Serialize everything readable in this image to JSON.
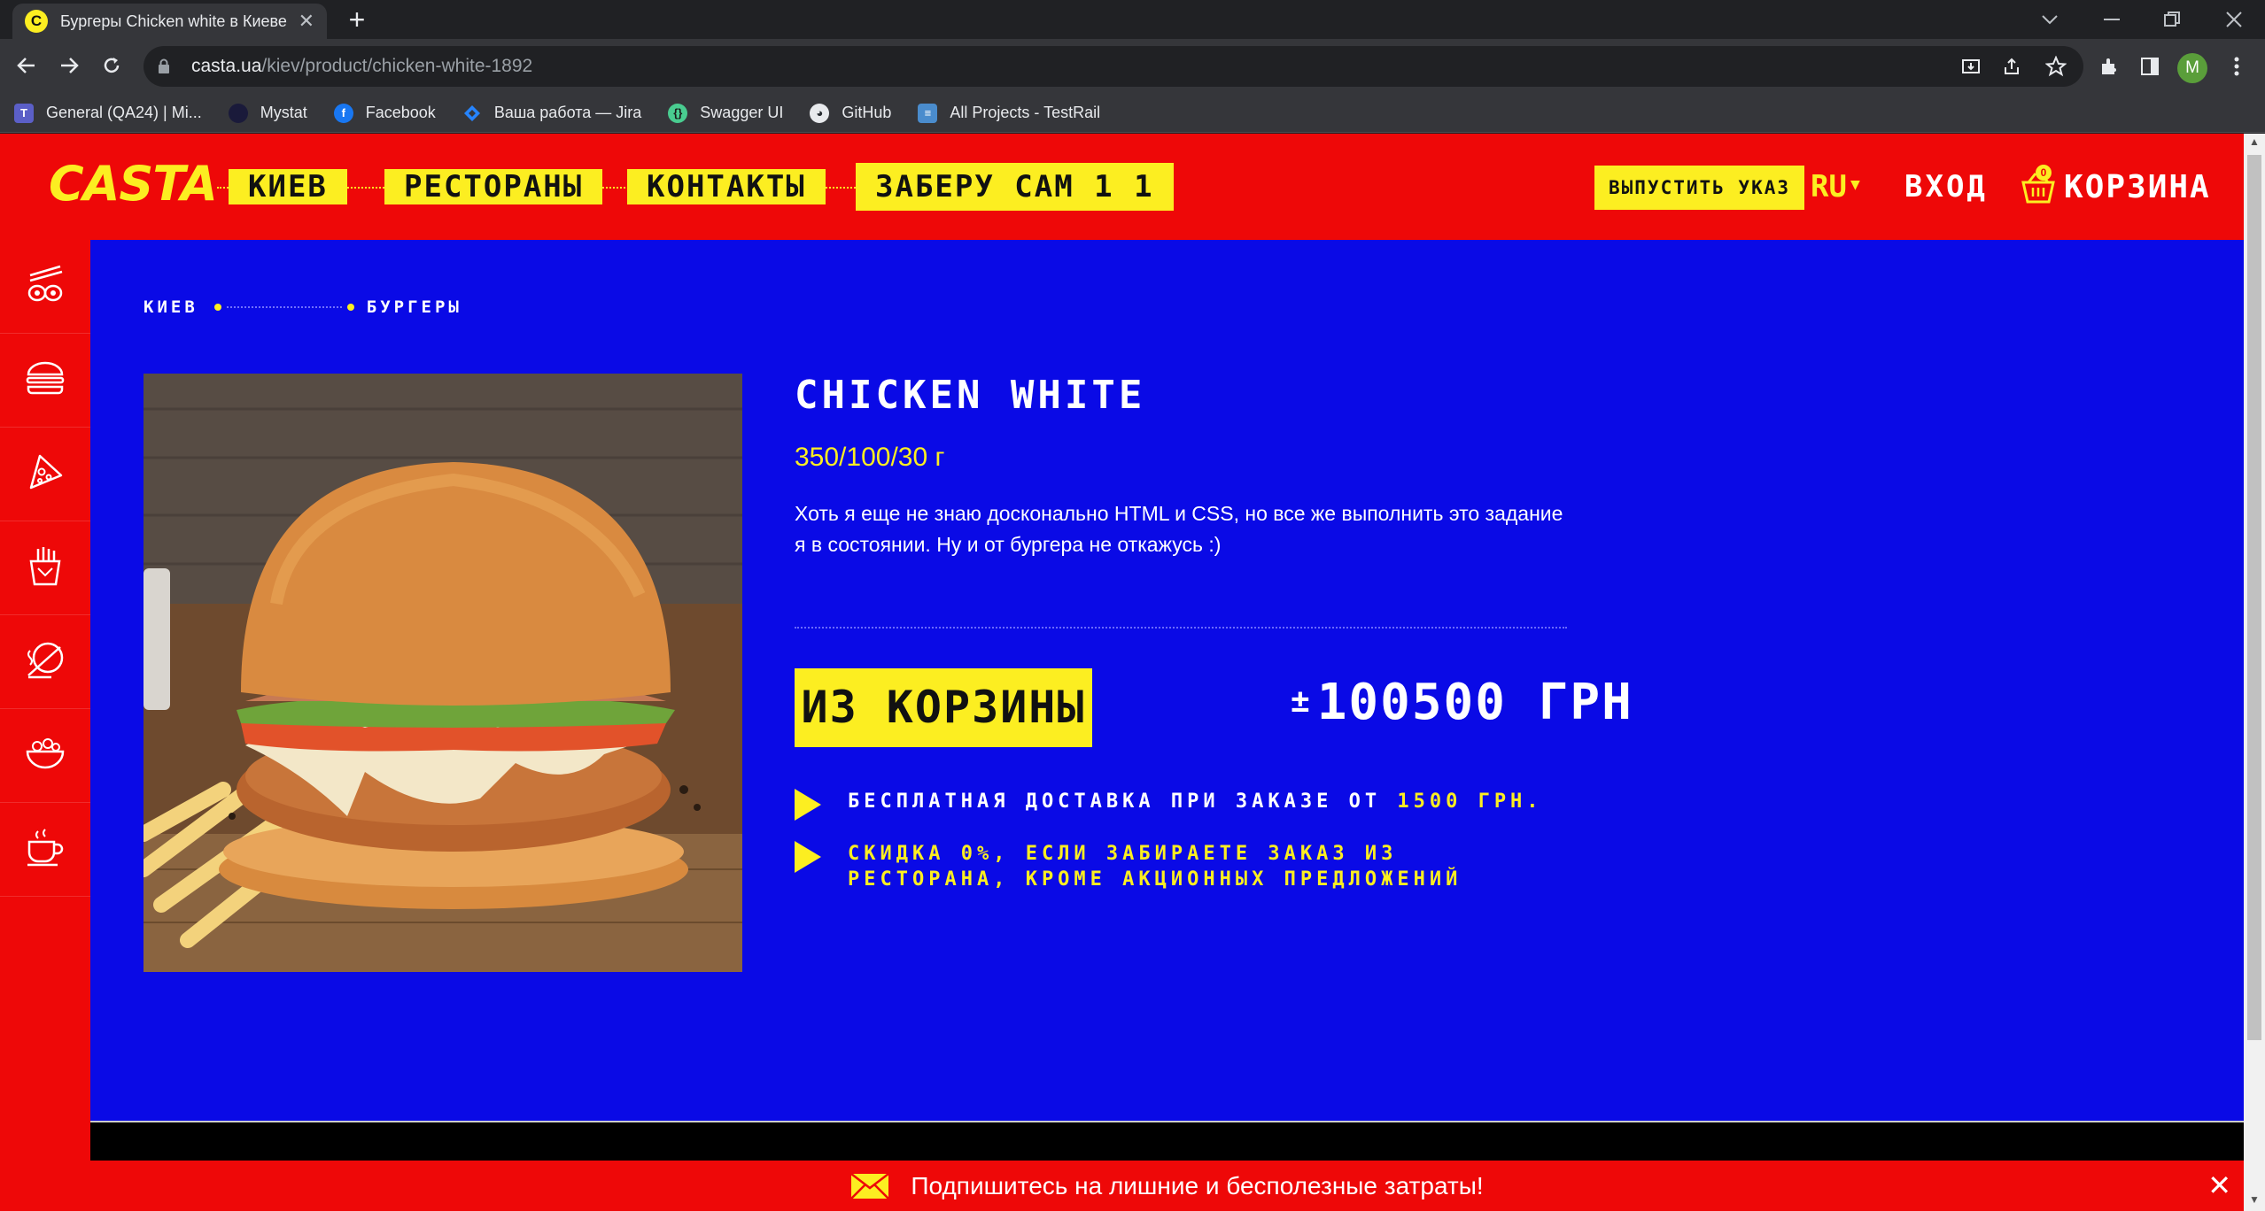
{
  "browser": {
    "tab_title": "Бургеры Chicken white в Киеве |",
    "tab_close": "✕",
    "new_tab": "+",
    "url_host": "casta.ua",
    "url_path": "/kiev/product/chicken-white-1892",
    "profile_initial": "M",
    "bookmarks": [
      {
        "label": "General (QA24) | Mi...",
        "icon": "teams-icon",
        "color": "#5b5fc7"
      },
      {
        "label": "Mystat",
        "icon": "mystat-icon",
        "color": "#1a1a3a"
      },
      {
        "label": "Facebook",
        "icon": "facebook-icon",
        "color": "#1877f2"
      },
      {
        "label": "Ваша работа — Jira",
        "icon": "jira-icon",
        "color": "#2684ff"
      },
      {
        "label": "Swagger UI",
        "icon": "swagger-icon",
        "color": "#49cc90"
      },
      {
        "label": "GitHub",
        "icon": "github-icon",
        "color": "#24292e"
      },
      {
        "label": "All Projects - TestRail",
        "icon": "testrail-icon",
        "color": "#4a8ccd"
      }
    ]
  },
  "header": {
    "logo": "CASTA",
    "nav": [
      "КИЕВ",
      "РЕСТОРАНЫ",
      "КОНТАКТЫ",
      "ЗАБЕРУ САМ 1 1"
    ],
    "ukaz_button": "ВЫПУСТИТЬ УКАЗ",
    "lang": "RU",
    "login": "ВХОД",
    "cart_label": "КОРЗИНА",
    "cart_count": "0"
  },
  "sidebar": {
    "items": [
      "sushi-icon",
      "burger-icon",
      "pizza-icon",
      "fries-icon",
      "hot-dish-icon",
      "salad-icon",
      "coffee-icon"
    ]
  },
  "breadcrumbs": [
    "КИЕВ",
    "БУРГЕРЫ"
  ],
  "product": {
    "title": "CHICKEN WHITE",
    "weight": "350/100/30 г",
    "description": "Хоть я еще не знаю досконально HTML и CSS, но все же выполнить это задание я в состоянии. Ну и от бургера не откажусь :)",
    "button": "ИЗ КОРЗИНЫ",
    "price_prefix": "±",
    "price": "100500 ГРН",
    "delivery_note": "БЕСПЛАТНАЯ ДОСТАВКА ПРИ ЗАКАЗЕ ОТ ",
    "delivery_amount": "1500 ГРН.",
    "discount_note": "СКИДКА 0%, ЕСЛИ ЗАБИРАЕТЕ ЗАКАЗ ИЗ РЕСТОРАНА, КРОМЕ АКЦИОННЫХ ПРЕДЛОЖЕНИЙ"
  },
  "subscribe": {
    "text": "Подпишитесь на лишние и бесполезные затраты!",
    "close": "✕"
  },
  "colors": {
    "brand_red": "#ee0808",
    "brand_yellow": "#fcee21",
    "content_blue": "#0a0ae6"
  }
}
